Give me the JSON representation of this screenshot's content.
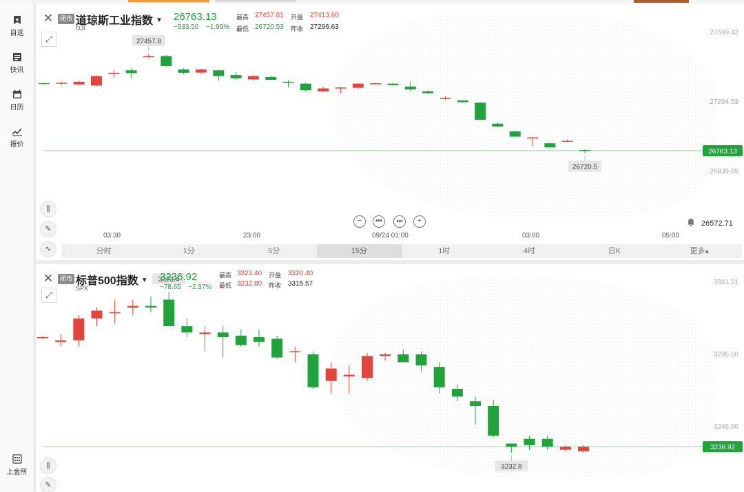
{
  "sidebar": {
    "items": [
      {
        "label": "自选",
        "icon": "bookmark-icon"
      },
      {
        "label": "快讯",
        "icon": "news-icon"
      },
      {
        "label": "日历",
        "icon": "calendar-icon"
      },
      {
        "label": "报价",
        "icon": "trend-chart-icon"
      }
    ],
    "bottom_item": {
      "label": "上金所",
      "icon": "exchange-building-icon"
    }
  },
  "panels": [
    {
      "status_badge": "闭市",
      "name": "道琼斯工业指数",
      "code": "DJI",
      "last": "26763.13",
      "change": "−533.50",
      "change_pct": "−1.95%",
      "high_label": "最高",
      "high": "27457.81",
      "open_label": "开盘",
      "open": "27413.60",
      "low_label": "最低",
      "low": "26720.53",
      "prev_close_label": "昨收",
      "prev_close": "27296.63",
      "price_axis": [
        "27569.42",
        "27204.53",
        "26839.65"
      ],
      "current_tag": "26763.13",
      "max_callout": "27457.8",
      "min_callout": "26720.5",
      "time_axis": [
        "03:30",
        "23:00",
        "09/24 01:00",
        "03:00",
        "05:00"
      ],
      "alarm_value": "26572.71",
      "period_tabs": [
        "分时",
        "1分",
        "5分",
        "15分",
        "1时",
        "4时",
        "日K",
        "更多▴"
      ],
      "active_tab": "15分"
    },
    {
      "status_badge": "闭市",
      "name": "标普500指数",
      "code": "SPX",
      "last": "3236.92",
      "change": "−78.65",
      "change_pct": "−2.37%",
      "high_label": "最高",
      "high": "3323.40",
      "open_label": "开盘",
      "open": "3320.40",
      "low_label": "最低",
      "low": "3232.80",
      "prev_close_label": "昨收",
      "prev_close": "3315.57",
      "price_axis": [
        "3341.21",
        "3295.00",
        "3248.80"
      ],
      "current_tag": "3236.92",
      "max_callout": "3323.4",
      "min_callout": "3232.8"
    }
  ],
  "colors": {
    "up": "#e2453c",
    "down": "#21a33c",
    "accent": "#f39a3b"
  },
  "chart_data": [
    {
      "type": "candlestick",
      "title": "道琼斯工业指数",
      "y_ticks": [
        27569.42,
        27204.53,
        26839.65
      ],
      "candles": [
        {
          "o": 27303,
          "h": 27305,
          "l": 27296,
          "c": 27300
        },
        {
          "o": 27300,
          "h": 27310,
          "l": 27295,
          "c": 27305
        },
        {
          "o": 27296,
          "h": 27318,
          "l": 27292,
          "c": 27310
        },
        {
          "o": 27290,
          "h": 27345,
          "l": 27285,
          "c": 27340
        },
        {
          "o": 27355,
          "h": 27370,
          "l": 27330,
          "c": 27357
        },
        {
          "o": 27370,
          "h": 27380,
          "l": 27330,
          "c": 27355
        },
        {
          "o": 27440,
          "h": 27458,
          "l": 27432,
          "c": 27445
        },
        {
          "o": 27445,
          "h": 27450,
          "l": 27392,
          "c": 27392
        },
        {
          "o": 27375,
          "h": 27380,
          "l": 27350,
          "c": 27357
        },
        {
          "o": 27358,
          "h": 27378,
          "l": 27350,
          "c": 27375
        },
        {
          "o": 27370,
          "h": 27375,
          "l": 27315,
          "c": 27340
        },
        {
          "o": 27345,
          "h": 27360,
          "l": 27320,
          "c": 27328
        },
        {
          "o": 27322,
          "h": 27345,
          "l": 27315,
          "c": 27340
        },
        {
          "o": 27335,
          "h": 27340,
          "l": 27318,
          "c": 27320
        },
        {
          "o": 27310,
          "h": 27318,
          "l": 27282,
          "c": 27308
        },
        {
          "o": 27300,
          "h": 27305,
          "l": 27260,
          "c": 27265
        },
        {
          "o": 27260,
          "h": 27284,
          "l": 27255,
          "c": 27275
        },
        {
          "o": 27276,
          "h": 27282,
          "l": 27250,
          "c": 27280
        },
        {
          "o": 27278,
          "h": 27302,
          "l": 27272,
          "c": 27300
        },
        {
          "o": 27300,
          "h": 27304,
          "l": 27296,
          "c": 27302
        },
        {
          "o": 27300,
          "h": 27304,
          "l": 27290,
          "c": 27292
        },
        {
          "o": 27285,
          "h": 27310,
          "l": 27262,
          "c": 27270
        },
        {
          "o": 27260,
          "h": 27265,
          "l": 27245,
          "c": 27250
        },
        {
          "o": 27225,
          "h": 27235,
          "l": 27215,
          "c": 27225
        },
        {
          "o": 27212,
          "h": 27215,
          "l": 27200,
          "c": 27203
        },
        {
          "o": 27200,
          "h": 27205,
          "l": 27110,
          "c": 27110
        },
        {
          "o": 27090,
          "h": 27095,
          "l": 27075,
          "c": 27075
        },
        {
          "o": 27050,
          "h": 27055,
          "l": 27022,
          "c": 27022
        },
        {
          "o": 27015,
          "h": 27020,
          "l": 26970,
          "c": 27018
        },
        {
          "o": 26987,
          "h": 26990,
          "l": 26965,
          "c": 26965
        },
        {
          "o": 27000,
          "h": 27008,
          "l": 26996,
          "c": 27000
        },
        {
          "o": 26952,
          "h": 26955,
          "l": 26935,
          "c": 26948
        }
      ]
    },
    {
      "type": "candlestick",
      "title": "标普500指数",
      "y_ticks": [
        3341.21,
        3295.0,
        3248.8
      ],
      "candles": [
        {
          "o": 3306,
          "h": 3307,
          "l": 3305,
          "c": 3306
        },
        {
          "o": 3303,
          "h": 3308,
          "l": 3300,
          "c": 3304
        },
        {
          "o": 3304,
          "h": 3320,
          "l": 3300,
          "c": 3318
        },
        {
          "o": 3318,
          "h": 3325,
          "l": 3313,
          "c": 3323
        },
        {
          "o": 3322,
          "h": 3330,
          "l": 3315,
          "c": 3322
        },
        {
          "o": 3325,
          "h": 3330,
          "l": 3320,
          "c": 3326
        },
        {
          "o": 3326,
          "h": 3332,
          "l": 3322,
          "c": 3325
        },
        {
          "o": 3330,
          "h": 3335,
          "l": 3322,
          "c": 3313
        },
        {
          "o": 3313,
          "h": 3318,
          "l": 3306,
          "c": 3309
        },
        {
          "o": 3308,
          "h": 3313,
          "l": 3297,
          "c": 3309
        },
        {
          "o": 3309,
          "h": 3313,
          "l": 3293,
          "c": 3306
        },
        {
          "o": 3307,
          "h": 3311,
          "l": 3300,
          "c": 3301
        },
        {
          "o": 3306,
          "h": 3311,
          "l": 3300,
          "c": 3303
        },
        {
          "o": 3305,
          "h": 3307,
          "l": 3292,
          "c": 3293
        },
        {
          "o": 3297,
          "h": 3300,
          "l": 3290,
          "c": 3297
        },
        {
          "o": 3295,
          "h": 3297,
          "l": 3273,
          "c": 3274
        },
        {
          "o": 3278,
          "h": 3290,
          "l": 3270,
          "c": 3286
        },
        {
          "o": 3281,
          "h": 3288,
          "l": 3270,
          "c": 3282
        },
        {
          "o": 3280,
          "h": 3296,
          "l": 3278,
          "c": 3294
        },
        {
          "o": 3294,
          "h": 3296,
          "l": 3291,
          "c": 3295
        },
        {
          "o": 3295,
          "h": 3298,
          "l": 3290,
          "c": 3290
        },
        {
          "o": 3295,
          "h": 3297,
          "l": 3284,
          "c": 3288
        },
        {
          "o": 3287,
          "h": 3290,
          "l": 3270,
          "c": 3274
        },
        {
          "o": 3273,
          "h": 3276,
          "l": 3265,
          "c": 3268
        },
        {
          "o": 3265,
          "h": 3268,
          "l": 3250,
          "c": 3262
        },
        {
          "o": 3262,
          "h": 3266,
          "l": 3242,
          "c": 3243
        },
        {
          "o": 3238,
          "h": 3238,
          "l": 3232,
          "c": 3236
        },
        {
          "o": 3241,
          "h": 3243,
          "l": 3234,
          "c": 3237
        },
        {
          "o": 3241,
          "h": 3243,
          "l": 3234,
          "c": 3236
        },
        {
          "o": 3234,
          "h": 3237,
          "l": 3233,
          "c": 3236
        },
        {
          "o": 3233,
          "h": 3237,
          "l": 3232,
          "c": 3236
        }
      ]
    }
  ]
}
